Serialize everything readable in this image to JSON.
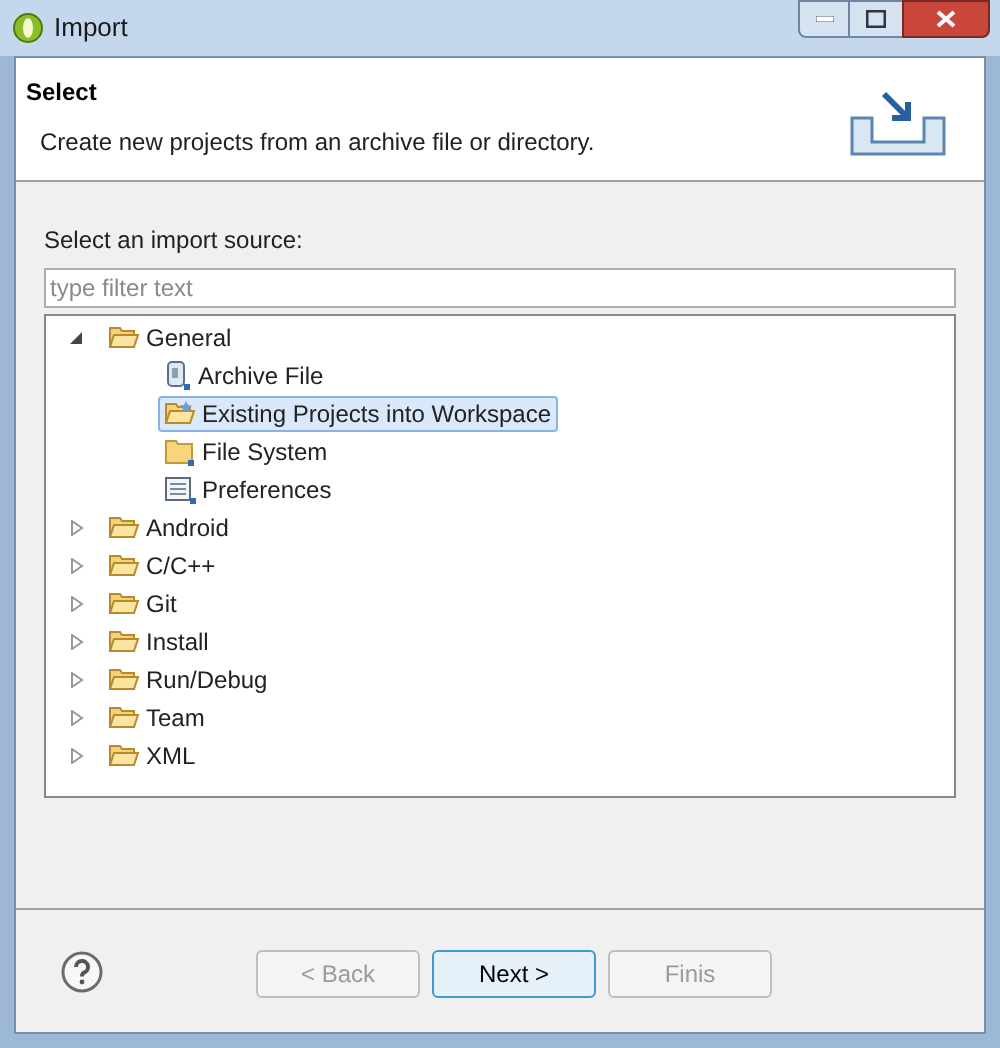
{
  "window": {
    "title": "Import"
  },
  "header": {
    "title": "Select",
    "description": "Create new projects from an archive file or directory."
  },
  "source_label": "Select an import source:",
  "filter": {
    "placeholder": "type filter text"
  },
  "tree": [
    {
      "label": "General",
      "kind": "folder",
      "expanded": true,
      "selected": false,
      "children": [
        {
          "label": "Archive File",
          "kind": "archive",
          "selected": false
        },
        {
          "label": "Existing Projects into Workspace",
          "kind": "projects",
          "selected": true
        },
        {
          "label": "File System",
          "kind": "filesystem",
          "selected": false
        },
        {
          "label": "Preferences",
          "kind": "preferences",
          "selected": false
        }
      ]
    },
    {
      "label": "Android",
      "kind": "folder",
      "expanded": false,
      "selected": false
    },
    {
      "label": "C/C++",
      "kind": "folder",
      "expanded": false,
      "selected": false
    },
    {
      "label": "Git",
      "kind": "folder",
      "expanded": false,
      "selected": false
    },
    {
      "label": "Install",
      "kind": "folder",
      "expanded": false,
      "selected": false
    },
    {
      "label": "Run/Debug",
      "kind": "folder",
      "expanded": false,
      "selected": false
    },
    {
      "label": "Team",
      "kind": "folder",
      "expanded": false,
      "selected": false
    },
    {
      "label": "XML",
      "kind": "folder",
      "expanded": false,
      "selected": false
    }
  ],
  "buttons": [
    {
      "label": "< Back",
      "disabled": true,
      "default": false
    },
    {
      "label": "Next >",
      "disabled": false,
      "default": true
    },
    {
      "label": "Finis",
      "disabled": true,
      "default": false
    }
  ]
}
